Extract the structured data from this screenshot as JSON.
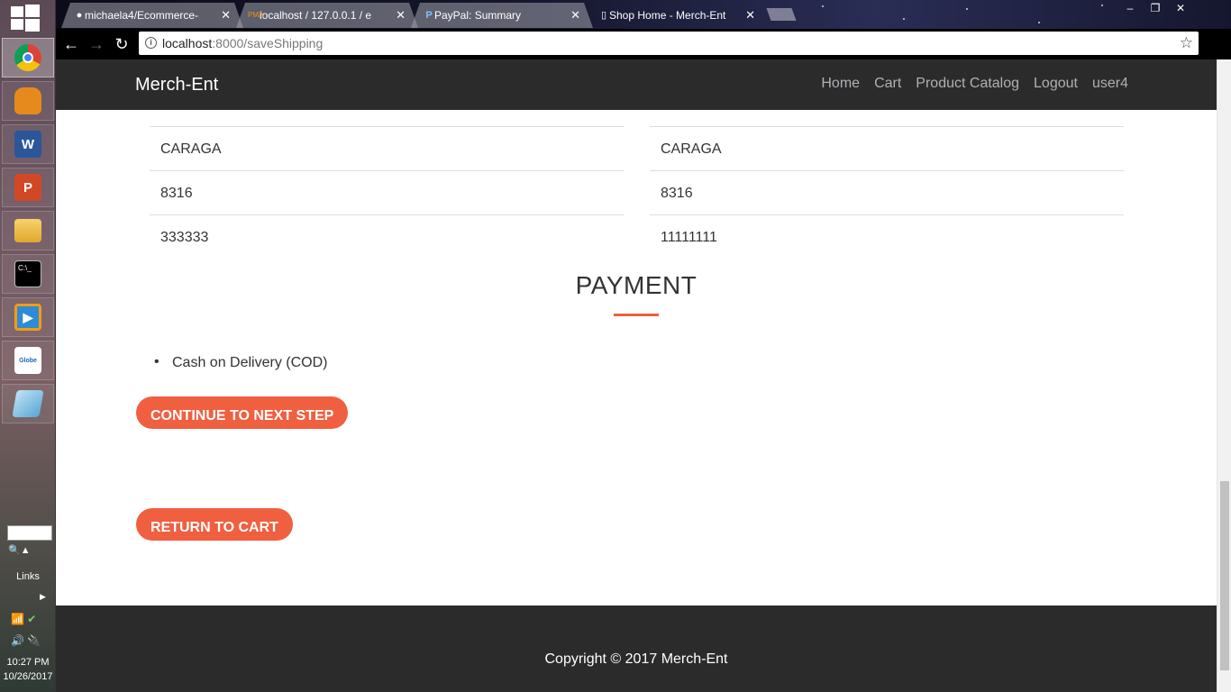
{
  "taskbar": {
    "start_icon": "windows-logo-icon",
    "apps": [
      {
        "name": "chrome",
        "icon": "chrome-icon",
        "active": true
      },
      {
        "name": "backpack",
        "icon": "backpack-icon",
        "active": false
      },
      {
        "name": "word",
        "icon": "word-icon",
        "letter": "W",
        "active": false
      },
      {
        "name": "powerpoint",
        "icon": "powerpoint-icon",
        "letter": "P",
        "active": false
      },
      {
        "name": "file-explorer",
        "icon": "folder-icon",
        "active": false
      },
      {
        "name": "command-prompt",
        "icon": "terminal-icon",
        "letter": "C:\\_",
        "active": false
      },
      {
        "name": "media-player",
        "icon": "media-player-icon",
        "active": false
      },
      {
        "name": "globe-broadband",
        "icon": "globe-icon",
        "letter": "Globe",
        "active": false
      },
      {
        "name": "notepad",
        "icon": "notepad-icon",
        "active": false
      }
    ],
    "links_label": "Links",
    "clock_time": "10:27 PM",
    "clock_date": "10/26/2017"
  },
  "browser": {
    "tabs": [
      {
        "title": "michaela4/Ecommerce-",
        "icon": "github-icon",
        "active": false
      },
      {
        "title": "localhost / 127.0.0.1 / e",
        "icon": "phpmyadmin-icon",
        "active": false
      },
      {
        "title": "PayPal: Summary",
        "icon": "paypal-icon",
        "active": false
      },
      {
        "title": "Shop Home - Merch-Ent",
        "icon": "page-icon",
        "active": true
      }
    ],
    "url_host": "localhost",
    "url_rest": ":8000/saveShipping"
  },
  "page": {
    "brand": "Merch-Ent",
    "nav": [
      "Home",
      "Cart",
      "Product Catalog",
      "Logout",
      "user4"
    ],
    "left_rows": [
      "CARAGA",
      "8316",
      "333333"
    ],
    "right_rows": [
      "CARAGA",
      "8316",
      "11111111"
    ],
    "payment_title": "PAYMENT",
    "payment_options": [
      "Cash on Delivery (COD)"
    ],
    "continue_label": "CONTINUE TO NEXT STEP",
    "return_label": "RETURN TO CART",
    "footer": "Copyright © 2017 Merch-Ent"
  },
  "colors": {
    "accent": "#f05f40",
    "navbar": "#2b2b2b",
    "nav_link": "#aeb1b5"
  }
}
